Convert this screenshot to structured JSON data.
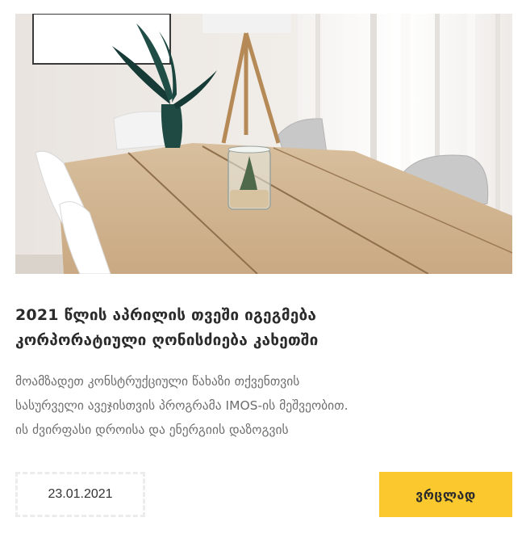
{
  "article": {
    "image": {
      "alt": "dining table with vase and plant terrarium",
      "icon": "photo-icon"
    },
    "title_line1": "2021 წლის აპრილის თვეში იგეგმება",
    "title_line2": "კორპორატიული ღონისძიება კახეთში",
    "desc_line1": "მოამზადეთ კონსტრუქციული წახაზი თქვენთვის",
    "desc_line2": "სასურველი ავეჯისთვის პროგრამა IMOS-ის მეშვეობით.",
    "desc_line3": "ის ძვირფასი დროისა და ენერგიის დაზოგვის",
    "date": "23.01.2021",
    "button_label": "ვრცლად"
  },
  "colors": {
    "accent": "#fbc82d",
    "title": "#2b2b2b",
    "text": "#6e6e6e",
    "date_border": "#ececec"
  }
}
